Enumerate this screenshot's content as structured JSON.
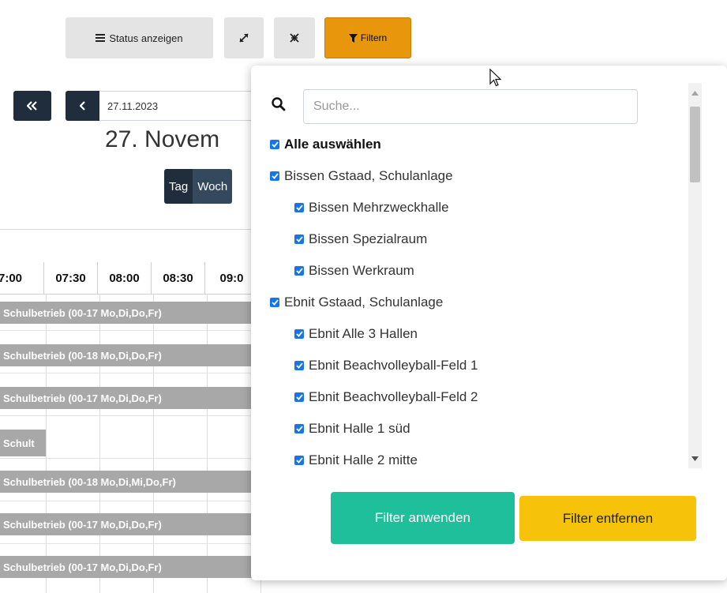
{
  "toolbar": {
    "status_label": "Status anzeigen",
    "filter_label": "Filtern"
  },
  "navigation": {
    "date_value": "27.11.2023",
    "big_date": "27. Novem",
    "views": [
      "Tag",
      "Woch"
    ]
  },
  "timeline": {
    "times": [
      "7:00",
      "07:30",
      "08:00",
      "08:30",
      "09:0"
    ],
    "bars": [
      "Schulbetrieb (00-17 Mo,Di,Do,Fr)",
      "Schulbetrieb (00-18 Mo,Di,Do,Fr)",
      "Schulbetrieb (00-17 Mo,Di,Do,Fr)",
      "Schult",
      "Schulbetrieb (00-18 Mo,Di,Mi,Do,Fr)",
      "Schulbetrieb (00-17 Mo,Di,Do,Fr)",
      "Schulbetrieb (00-17 Mo,Di,Do,Fr)"
    ]
  },
  "filter": {
    "search_placeholder": "Suche...",
    "items": [
      {
        "label": "Alle auswählen",
        "checked": true
      },
      {
        "label": "Bissen Gstaad, Schulanlage",
        "checked": true
      },
      {
        "label": "Bissen Mehrzweckhalle",
        "checked": true
      },
      {
        "label": "Bissen Spezialraum",
        "checked": true
      },
      {
        "label": "Bissen Werkraum",
        "checked": true
      },
      {
        "label": "Ebnit Gstaad, Schulanlage",
        "checked": true
      },
      {
        "label": "Ebnit Alle 3 Hallen",
        "checked": true
      },
      {
        "label": "Ebnit Beachvolleyball-Feld 1",
        "checked": true
      },
      {
        "label": "Ebnit Beachvolleyball-Feld 2",
        "checked": true
      },
      {
        "label": "Ebnit Halle 1 süd",
        "checked": true
      },
      {
        "label": "Ebnit Halle 2 mitte",
        "checked": true
      }
    ],
    "apply_label": "Filter anwenden",
    "remove_label": "Filter entfernen"
  },
  "colors": {
    "filter_button": "#e8960c",
    "apply_button": "#1fbf9c",
    "remove_button": "#f7c30a",
    "checkbox": "#1a73e8",
    "event_bar": "#a8a8a8"
  }
}
